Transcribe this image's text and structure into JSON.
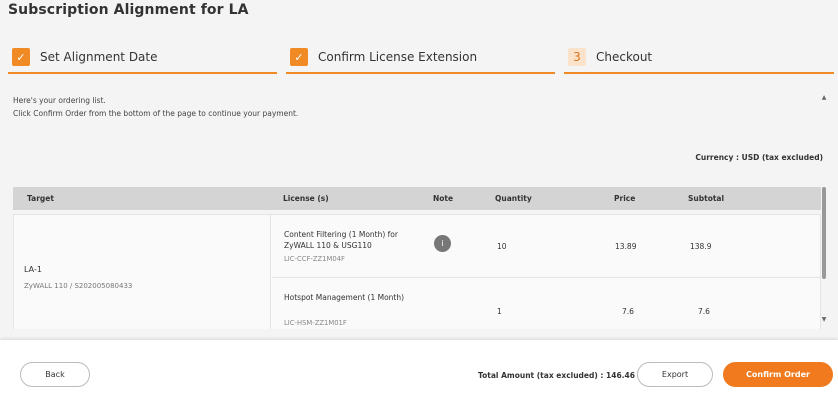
{
  "page": {
    "title": "Subscription Alignment for LA"
  },
  "steps": [
    {
      "label": "Set Alignment Date",
      "marker": "✓",
      "state": "done"
    },
    {
      "label": "Confirm License Extension",
      "marker": "✓",
      "state": "done"
    },
    {
      "label": "Checkout",
      "marker": "3",
      "state": "current"
    }
  ],
  "info": {
    "line1": "Here's your ordering list.",
    "line2": "Click Confirm Order from the bottom of the page to continue your payment."
  },
  "currency": "Currency : USD  (tax excluded)",
  "table": {
    "headers": [
      "Target",
      "License (s)",
      "Note",
      "Quantity",
      "Price",
      "Subtotal"
    ],
    "target": {
      "name": "LA-1",
      "device": "ZyWALL 110 / S202005080433"
    },
    "rows": [
      {
        "license": "Content Filtering (1 Month) for ZyWALL 110 & USG110",
        "code": "LIC-CCF-ZZ1M04F",
        "note_icon": "i",
        "quantity": "10",
        "price": "13.89",
        "subtotal": "138.9"
      },
      {
        "license": "Hotspot Management (1 Month)",
        "code": "LIC-HSM-ZZ1M01F",
        "note_icon": "",
        "quantity": "1",
        "price": "7.6",
        "subtotal": "7.6"
      }
    ]
  },
  "footer": {
    "back_label": "Back",
    "total_label": "Total Amount (tax excluded) : 146.46",
    "export_label": "Export",
    "confirm_label": "Confirm Order"
  },
  "colors": {
    "accent": "#f08a25",
    "step_number_bg": "#fbe3cb",
    "confirm_button": "#f07a1d"
  },
  "icons": {
    "step_done": "check-icon",
    "note": "info-icon",
    "scroll_up": "arrow-up-icon",
    "scroll_down": "arrow-down-icon"
  }
}
